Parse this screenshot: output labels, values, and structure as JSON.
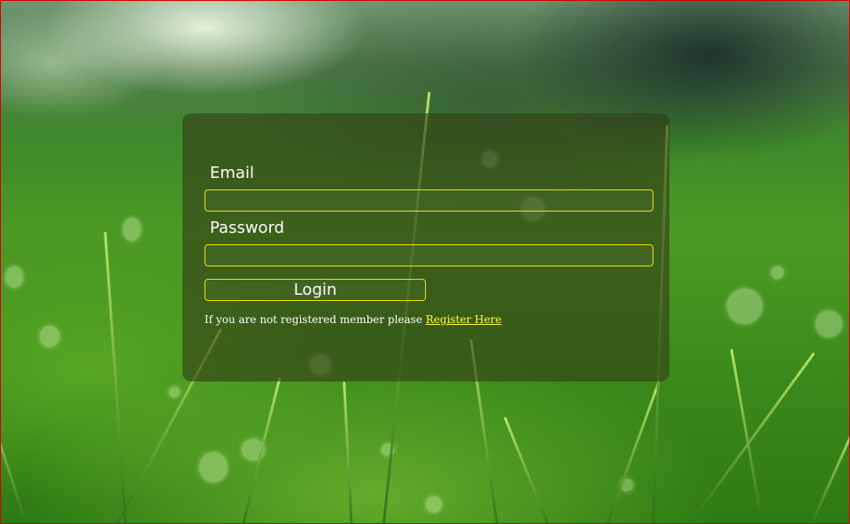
{
  "login_form": {
    "email_label": "Email",
    "email_value": "",
    "password_label": "Password",
    "password_value": "",
    "login_button_label": "Login",
    "register_prompt": "If you are not registered member please ",
    "register_link_label": "Register Here"
  },
  "theme": {
    "input_border_color": "#e6e600",
    "link_color": "#ffff33",
    "panel_color": "#343e16",
    "page_border_color": "#d40000"
  }
}
